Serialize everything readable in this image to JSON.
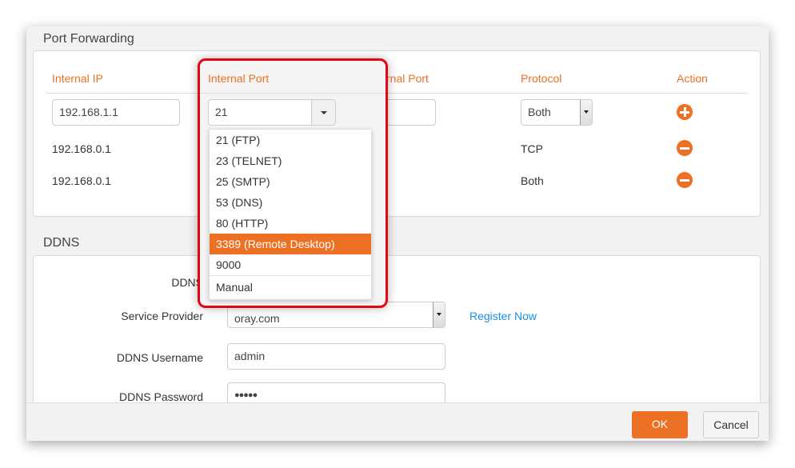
{
  "port_forwarding": {
    "title": "Port Forwarding",
    "headers": [
      "Internal IP",
      "Internal Port",
      "External Port",
      "Protocol",
      "Action"
    ],
    "new_row": {
      "internal_ip": "192.168.1.1",
      "internal_port": "21",
      "external_port": "21",
      "protocol": "Both"
    },
    "rows": [
      {
        "internal_ip": "192.168.0.1",
        "external_port": "0",
        "protocol": "TCP"
      },
      {
        "internal_ip": "192.168.0.1",
        "external_port": "0",
        "protocol": "Both"
      }
    ],
    "port_options": [
      "21 (FTP)",
      "23 (TELNET)",
      "25 (SMTP)",
      "53 (DNS)",
      "80 (HTTP)",
      "3389 (Remote Desktop)",
      "9000",
      "Manual"
    ],
    "highlighted_option": "3389 (Remote Desktop)"
  },
  "ddns": {
    "title": "DDNS",
    "ddns_label": "DDNS",
    "service_provider_label": "Service Provider",
    "service_provider_value": "oray.com",
    "register_link": "Register Now",
    "username_label": "DDNS Username",
    "username_value": "admin",
    "password_label": "DDNS Password",
    "password_value": "●●●●●"
  },
  "footer": {
    "ok": "OK",
    "cancel": "Cancel"
  },
  "colors": {
    "accent": "#ec7125",
    "link": "#1a8fe3",
    "highlight_box": "#e30613"
  }
}
